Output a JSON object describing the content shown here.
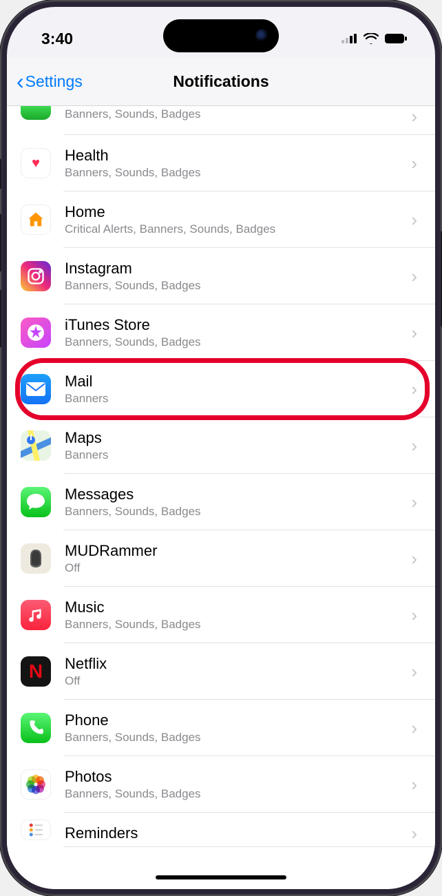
{
  "status": {
    "time": "3:40"
  },
  "nav": {
    "back_label": "Settings",
    "title": "Notifications"
  },
  "apps": {
    "partial_sub": "Banners, Sounds, Badges",
    "health": {
      "name": "Health",
      "sub": "Banners, Sounds, Badges"
    },
    "home": {
      "name": "Home",
      "sub": "Critical Alerts, Banners, Sounds, Badges"
    },
    "instagram": {
      "name": "Instagram",
      "sub": "Banners, Sounds, Badges"
    },
    "itunes": {
      "name": "iTunes Store",
      "sub": "Banners, Sounds, Badges"
    },
    "mail": {
      "name": "Mail",
      "sub": "Banners"
    },
    "maps": {
      "name": "Maps",
      "sub": "Banners"
    },
    "messages": {
      "name": "Messages",
      "sub": "Banners, Sounds, Badges"
    },
    "mudrammer": {
      "name": "MUDRammer",
      "sub": "Off"
    },
    "music": {
      "name": "Music",
      "sub": "Banners, Sounds, Badges"
    },
    "netflix": {
      "name": "Netflix",
      "sub": "Off"
    },
    "phone": {
      "name": "Phone",
      "sub": "Banners, Sounds, Badges"
    },
    "photos": {
      "name": "Photos",
      "sub": "Banners, Sounds, Badges"
    },
    "reminders": {
      "name": "Reminders"
    }
  },
  "annotation": {
    "highlighted_row": "mail"
  }
}
